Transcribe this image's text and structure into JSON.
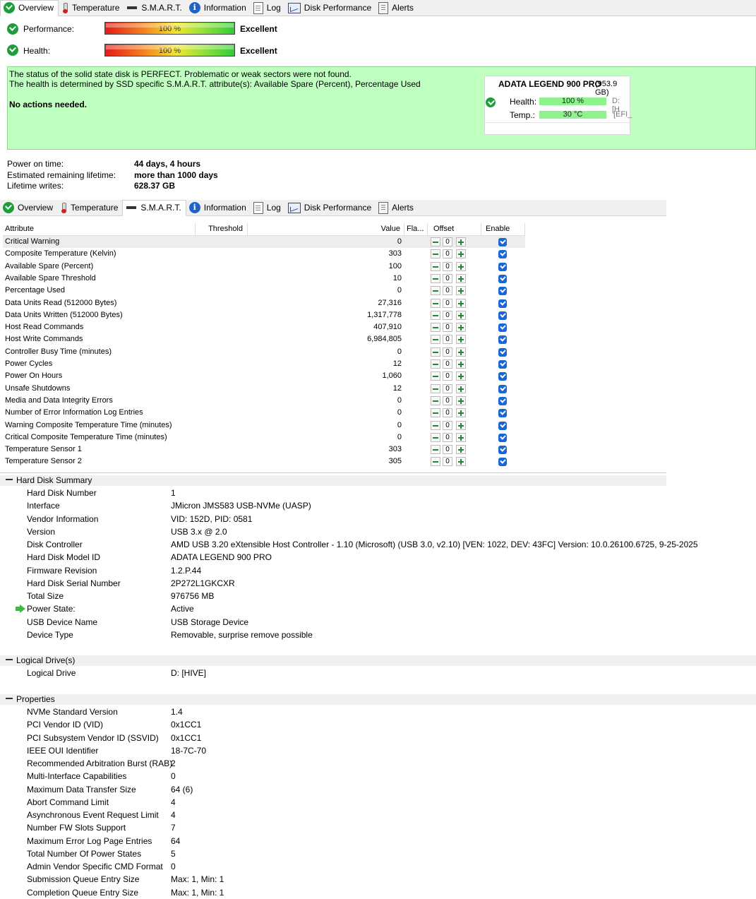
{
  "tabs_top": [
    {
      "label": "Overview",
      "icon": "check-icon",
      "active": true
    },
    {
      "label": "Temperature",
      "icon": "thermometer-icon"
    },
    {
      "label": "S.M.A.R.T.",
      "icon": "smart-icon"
    },
    {
      "label": "Information",
      "icon": "info-icon"
    },
    {
      "label": "Log",
      "icon": "log-icon"
    },
    {
      "label": "Disk Performance",
      "icon": "chart-icon"
    },
    {
      "label": "Alerts",
      "icon": "alerts-icon"
    }
  ],
  "tabs_mid": [
    {
      "label": "Overview",
      "icon": "check-icon"
    },
    {
      "label": "Temperature",
      "icon": "thermometer-icon"
    },
    {
      "label": "S.M.A.R.T.",
      "icon": "smart-icon",
      "active": true
    },
    {
      "label": "Information",
      "icon": "info-icon"
    },
    {
      "label": "Log",
      "icon": "log-icon"
    },
    {
      "label": "Disk Performance",
      "icon": "chart-icon"
    },
    {
      "label": "Alerts",
      "icon": "alerts-icon"
    }
  ],
  "overview": {
    "performance_label": "Performance:",
    "performance_value": "100 %",
    "performance_fraction": 1.0,
    "performance_rating": "Excellent",
    "health_label": "Health:",
    "health_value": "100 %",
    "health_fraction": 1.0,
    "health_rating": "Excellent",
    "status_line1": "The status of the solid state disk is PERFECT. Problematic or weak sectors were not found.",
    "status_line2": "The health is determined by SSD specific S.M.A.R.T. attribute(s):  Available Spare (Percent), Percentage Used",
    "actions": "No actions needed.",
    "card": {
      "name": "ADATA LEGEND 900 PRO",
      "size": "(953.9 GB)",
      "health_label": "Health:",
      "health_value": "100 %",
      "temp_label": "Temp.:",
      "temp_value": "30 °C",
      "drive1": "D: [H",
      "drive2": "[EFI_"
    },
    "power_on_label": "Power on time:",
    "power_on_value": "44 days, 4 hours",
    "remaining_label": "Estimated remaining lifetime:",
    "remaining_value": "more than 1000 days",
    "writes_label": "Lifetime writes:",
    "writes_value": "628.37 GB",
    "colors": {
      "status_bg": "#bfffbf",
      "accent_green": "#1f9d3a"
    }
  },
  "smart": {
    "headers": {
      "attribute": "Attribute",
      "threshold": "Threshold",
      "value": "Value",
      "flags": "Fla...",
      "offset": "Offset",
      "enable": "Enable"
    },
    "rows": [
      {
        "attribute": "Critical Warning",
        "value": "0",
        "offset": "0"
      },
      {
        "attribute": "Composite Temperature (Kelvin)",
        "value": "303",
        "offset": "0"
      },
      {
        "attribute": "Available Spare (Percent)",
        "value": "100",
        "offset": "0"
      },
      {
        "attribute": "Available Spare Threshold",
        "value": "10",
        "offset": "0"
      },
      {
        "attribute": "Percentage Used",
        "value": "0",
        "offset": "0"
      },
      {
        "attribute": "Data Units Read (512000 Bytes)",
        "value": "27,316",
        "offset": "0"
      },
      {
        "attribute": "Data Units Written (512000 Bytes)",
        "value": "1,317,778",
        "offset": "0"
      },
      {
        "attribute": "Host Read Commands",
        "value": "407,910",
        "offset": "0"
      },
      {
        "attribute": "Host Write Commands",
        "value": "6,984,805",
        "offset": "0"
      },
      {
        "attribute": "Controller Busy Time (minutes)",
        "value": "0",
        "offset": "0"
      },
      {
        "attribute": "Power Cycles",
        "value": "12",
        "offset": "0"
      },
      {
        "attribute": "Power On Hours",
        "value": "1,060",
        "offset": "0"
      },
      {
        "attribute": "Unsafe Shutdowns",
        "value": "12",
        "offset": "0"
      },
      {
        "attribute": "Media and Data Integrity Errors",
        "value": "0",
        "offset": "0"
      },
      {
        "attribute": "Number of Error Information Log Entries",
        "value": "0",
        "offset": "0"
      },
      {
        "attribute": "Warning Composite Temperature Time (minutes)",
        "value": "0",
        "offset": "0"
      },
      {
        "attribute": "Critical Composite Temperature Time (minutes)",
        "value": "0",
        "offset": "0"
      },
      {
        "attribute": "Temperature Sensor 1",
        "value": "303",
        "offset": "0"
      },
      {
        "attribute": "Temperature Sensor 2",
        "value": "305",
        "offset": "0"
      }
    ]
  },
  "info": {
    "summary_title": "Hard Disk Summary",
    "summary": [
      {
        "label": "Hard Disk Number",
        "value": "1"
      },
      {
        "label": "Interface",
        "value": "JMicron JMS583 USB-NVMe (UASP)"
      },
      {
        "label": "Vendor Information",
        "value": "VID: 152D, PID: 0581"
      },
      {
        "label": "Version",
        "value": "USB 3.x @ 2.0"
      },
      {
        "label": "Disk Controller",
        "value": "AMD USB 3.20 eXtensible Host Controller - 1.10 (Microsoft) (USB 3.0, v2.10) [VEN: 1022, DEV: 43FC] Version: 10.0.26100.6725, 9-25-2025"
      },
      {
        "label": "Hard Disk Model ID",
        "value": "ADATA LEGEND 900 PRO"
      },
      {
        "label": "Firmware Revision",
        "value": "1.2.P.44"
      },
      {
        "label": "Hard Disk Serial Number",
        "value": "2P272L1GKCXR"
      },
      {
        "label": "Total Size",
        "value": "976756 MB"
      },
      {
        "label": "Power State:",
        "value": "Active",
        "arrow": true
      },
      {
        "label": "USB Device Name",
        "value": "USB Storage Device"
      },
      {
        "label": "Device Type",
        "value": "Removable, surprise remove possible"
      }
    ],
    "logical_title": "Logical Drive(s)",
    "logical": [
      {
        "label": "Logical Drive",
        "value": "D: [HIVE]"
      }
    ],
    "properties_title": "Properties",
    "properties": [
      {
        "label": "NVMe Standard Version",
        "value": "1.4"
      },
      {
        "label": "PCI Vendor ID (VID)",
        "value": "0x1CC1"
      },
      {
        "label": "PCI Subsystem Vendor ID (SSVID)",
        "value": "0x1CC1"
      },
      {
        "label": "IEEE OUI Identifier",
        "value": "18-7C-70"
      },
      {
        "label": "Recommended Arbitration Burst (RAB)",
        "value": "2"
      },
      {
        "label": "Multi-Interface Capabilities",
        "value": "0"
      },
      {
        "label": "Maximum Data Transfer Size",
        "value": "64 (6)"
      },
      {
        "label": "Abort Command Limit",
        "value": "4"
      },
      {
        "label": "Asynchronous Event Request Limit",
        "value": "4"
      },
      {
        "label": "Number FW Slots Support",
        "value": "7"
      },
      {
        "label": "Maximum Error Log Page Entries",
        "value": "64"
      },
      {
        "label": "Total Number Of Power States",
        "value": "5"
      },
      {
        "label": "Admin Vendor Specific CMD Format",
        "value": "0"
      },
      {
        "label": "Submission Queue Entry Size",
        "value": "Max: 1, Min: 1"
      },
      {
        "label": "Completion Queue Entry Size",
        "value": "Max: 1, Min: 1"
      }
    ]
  }
}
